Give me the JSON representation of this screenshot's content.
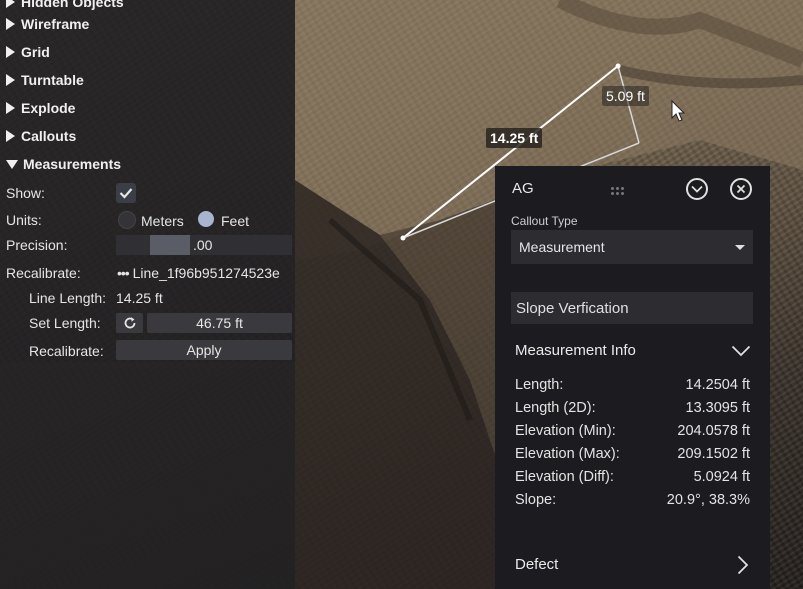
{
  "viewport": {
    "measure_label_main": "14.25 ft",
    "measure_label_rise": "5.09 ft"
  },
  "left_panel": {
    "sections": [
      {
        "label": "Hidden Objects",
        "expanded": false
      },
      {
        "label": "Wireframe",
        "expanded": false
      },
      {
        "label": "Grid",
        "expanded": false
      },
      {
        "label": "Turntable",
        "expanded": false
      },
      {
        "label": "Explode",
        "expanded": false
      },
      {
        "label": "Callouts",
        "expanded": false
      },
      {
        "label": "Measurements",
        "expanded": true
      }
    ],
    "measurements": {
      "show_label": "Show:",
      "show_checked": true,
      "units_label": "Units:",
      "unit_options": [
        "Meters",
        "Feet"
      ],
      "unit_selected": "Feet",
      "precision_label": "Precision:",
      "precision_value": ".00",
      "recalibrate_label": "Recalibrate:",
      "recalibrate_line": "Line_1f96b951274523e",
      "line_length_label": "Line Length:",
      "line_length_value": "14.25 ft",
      "set_length_label": "Set Length:",
      "set_length_value": "46.75 ft",
      "recalibrate2_label": "Recalibrate:",
      "apply_label": "Apply"
    }
  },
  "callout": {
    "title": "AG",
    "type_label": "Callout Type",
    "type_value": "Measurement",
    "name_value": "Slope Verfication",
    "info_header": "Measurement Info",
    "rows": [
      {
        "key": "Length:",
        "value": "14.2504 ft"
      },
      {
        "key": "Length (2D):",
        "value": "13.3095 ft"
      },
      {
        "key": "Elevation (Min):",
        "value": "204.0578 ft"
      },
      {
        "key": "Elevation (Max):",
        "value": "209.1502 ft"
      },
      {
        "key": "Elevation (Diff):",
        "value": "5.0924 ft"
      },
      {
        "key": "Slope:",
        "value": "20.9°, 38.3%"
      }
    ],
    "defect_header": "Defect"
  },
  "icons": [
    "checkmark-icon",
    "ellipsis-icon",
    "refresh-icon",
    "grip-icon",
    "chevron-down-icon",
    "close-icon",
    "chevron-right-icon",
    "cursor-icon"
  ]
}
